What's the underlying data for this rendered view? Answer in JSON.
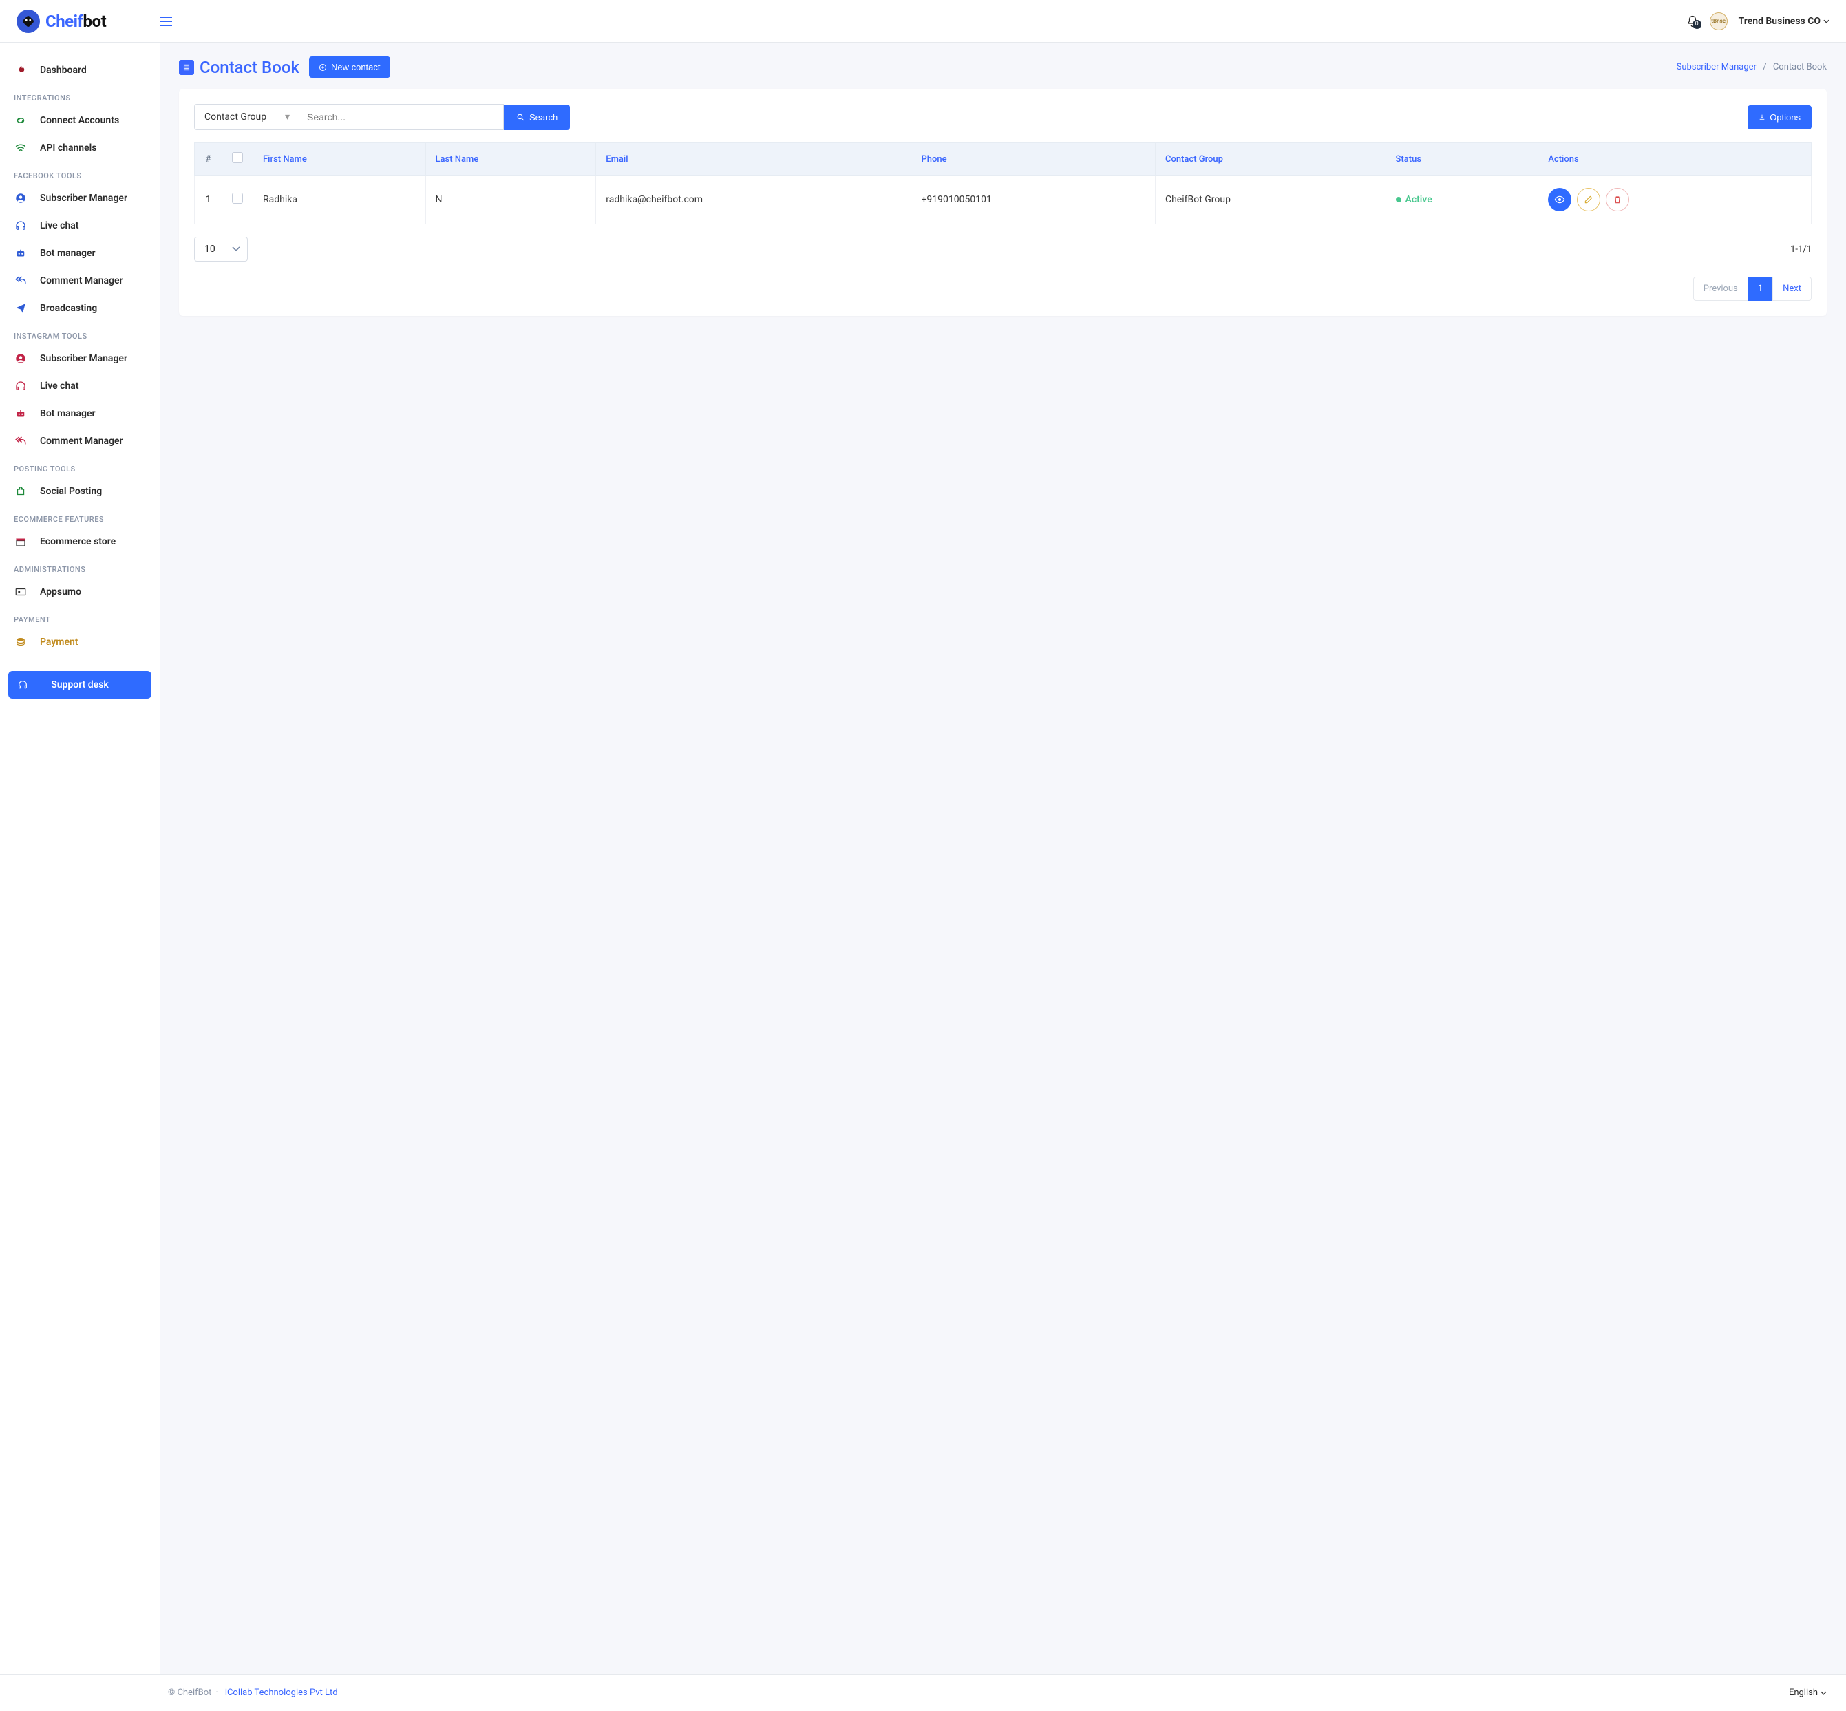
{
  "header": {
    "logo_text_a": "Cheif",
    "logo_text_b": "bot",
    "notification_count": "0",
    "client_name": "Trend Business CO"
  },
  "sidebar": {
    "dashboard": "Dashboard",
    "sections": {
      "integrations": "INTEGRATIONS",
      "facebook": "FACEBOOK TOOLS",
      "instagram": "INSTAGRAM TOOLS",
      "posting": "POSTING TOOLS",
      "ecommerce": "ECOMMERCE FEATURES",
      "admin": "ADMINISTRATIONS",
      "payment": "PAYMENT"
    },
    "items": {
      "connect_accounts": "Connect Accounts",
      "api_channels": "API channels",
      "fb_subscriber": "Subscriber Manager",
      "fb_livechat": "Live chat",
      "fb_bot": "Bot manager",
      "fb_comment": "Comment Manager",
      "fb_broadcast": "Broadcasting",
      "ig_subscriber": "Subscriber Manager",
      "ig_livechat": "Live chat",
      "ig_bot": "Bot manager",
      "ig_comment": "Comment Manager",
      "social_posting": "Social Posting",
      "ecom_store": "Ecommerce store",
      "appsumo": "Appsumo",
      "payment": "Payment"
    },
    "support": "Support desk"
  },
  "page": {
    "title": "Contact Book",
    "new_contact": "New contact",
    "breadcrumb_parent": "Subscriber Manager",
    "breadcrumb_current": "Contact Book"
  },
  "filters": {
    "group_select": "Contact Group",
    "search_placeholder": "Search...",
    "search_btn": "Search",
    "options_btn": "Options"
  },
  "table": {
    "headers": {
      "hash": "#",
      "first": "First Name",
      "last": "Last Name",
      "email": "Email",
      "phone": "Phone",
      "group": "Contact Group",
      "status": "Status",
      "actions": "Actions"
    },
    "rows": [
      {
        "num": "1",
        "first": "Radhika",
        "last": "N",
        "email": "radhika@cheifbot.com",
        "phone": "+919010050101",
        "group": "CheifBot Group",
        "status": "Active"
      }
    ],
    "page_size": "10",
    "result_count": "1-1/1"
  },
  "pagination": {
    "prev": "Previous",
    "page": "1",
    "next": "Next"
  },
  "footer": {
    "copyright": "© CheifBot",
    "dot": "·",
    "company": "iCollab Technologies Pvt Ltd",
    "lang": "English"
  }
}
